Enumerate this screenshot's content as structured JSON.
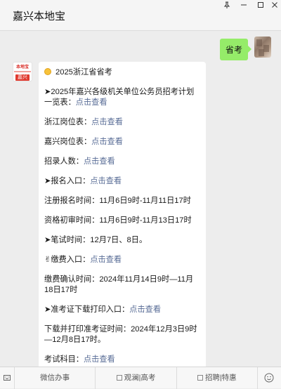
{
  "window": {
    "title": "嘉兴本地宝"
  },
  "user_message": {
    "text": "省考"
  },
  "bot_avatar": {
    "brand": "本地宝",
    "city": "嘉兴"
  },
  "bot_message": {
    "heading": "2025浙江省省考",
    "plan_prefix": "➤2025年嘉兴各级机关单位公务员招考计划一览表：",
    "plan_link": "点击查看",
    "zj_label": "浙江岗位表：",
    "zj_link": "点击查看",
    "jx_label": "嘉兴岗位表：",
    "jx_link": "点击查看",
    "recruit_label": "招录人数：",
    "recruit_link": "点击查看",
    "signup_label": "➤报名入口：",
    "signup_link": "点击查看",
    "register_time": "注册报名时间：11月6日9时-11月11日17时",
    "review_time": "资格初审时间：11月6日9时-11月13日17时",
    "exam_date": "➤笔试时间：12月7日、8日。",
    "pay_label": "✌缴费入口：",
    "pay_link": "点击查看",
    "pay_confirm": "缴费确认时间：2024年11月14日9时—11月18日17时",
    "ticket_label": "➤准考证下载打印入口：",
    "ticket_link": "点击查看",
    "ticket_time": "下载并打印准考证时间：2024年12月3日9时—12月8日17时。",
    "subject_label": "考试科目：",
    "subject_link": "点击查看"
  },
  "bottom_bar": {
    "tabs": [
      "微信办事",
      "观澜|高考",
      "招聘|特惠"
    ]
  },
  "colors": {
    "user_bubble": "#95ec69",
    "link": "#576b95",
    "background": "#ededed"
  }
}
